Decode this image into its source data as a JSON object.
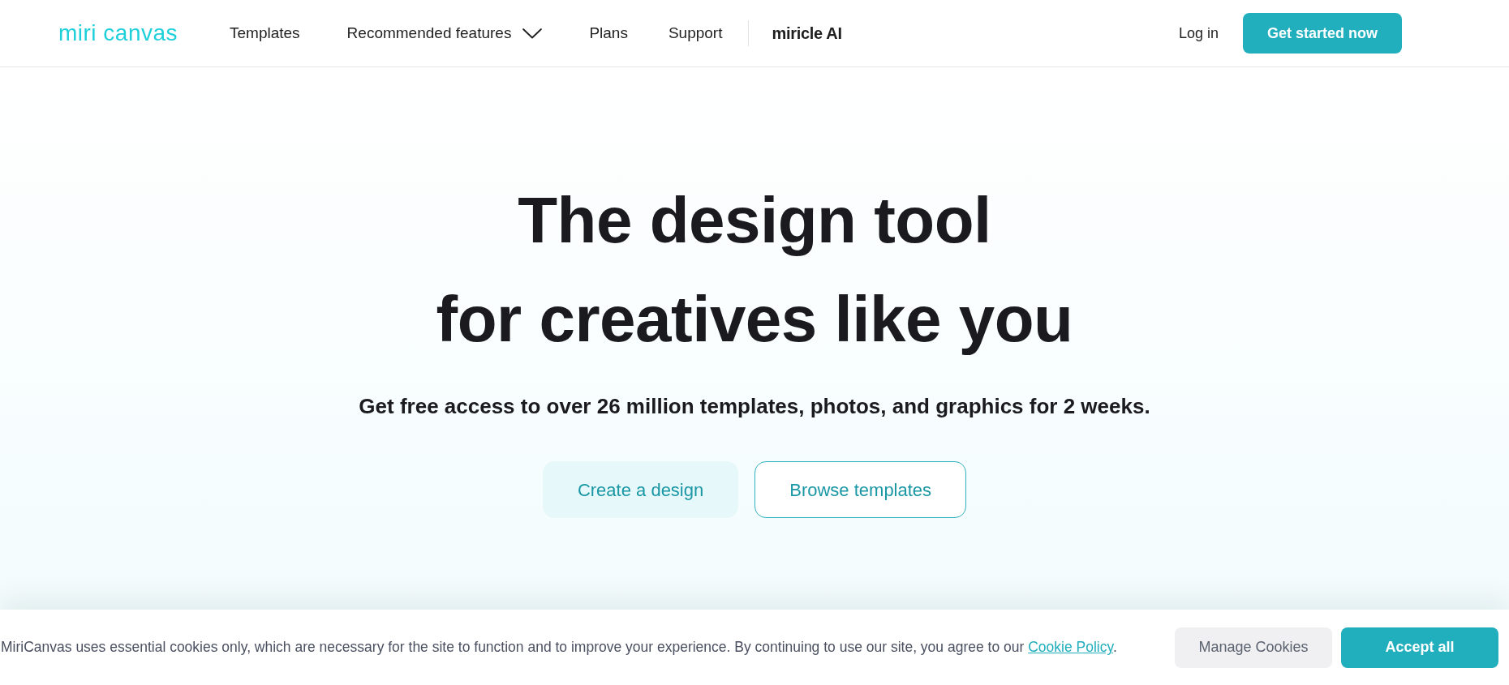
{
  "header": {
    "logo": "miri canvas",
    "nav": [
      {
        "label": "Templates",
        "kind": "link"
      },
      {
        "label": "Recommended features",
        "kind": "dropdown"
      },
      {
        "label": "Plans",
        "kind": "link"
      },
      {
        "label": "Support",
        "kind": "link"
      }
    ],
    "brand_link": "miricle AI",
    "login": "Log in",
    "cta": "Get started now"
  },
  "hero": {
    "title_lines": [
      "The design tool",
      "for creatives like you"
    ],
    "subtitle": "Get free access to over 26 million templates, photos, and graphics for 2 weeks.",
    "buttons": [
      {
        "label": "Create a design",
        "kind": "filled"
      },
      {
        "label": "Browse templates",
        "kind": "outline"
      }
    ]
  },
  "cookie_banner": {
    "text": "MiriCanvas uses essential cookies only, which are necessary for the site to function and to improve your experience. By continuing to use our site, you agree to our ",
    "link": "Cookie Policy",
    "after": ".",
    "buttons": [
      {
        "label": "Manage Cookies",
        "kind": "secondary"
      },
      {
        "label": "Accept all",
        "kind": "primary"
      }
    ]
  }
}
